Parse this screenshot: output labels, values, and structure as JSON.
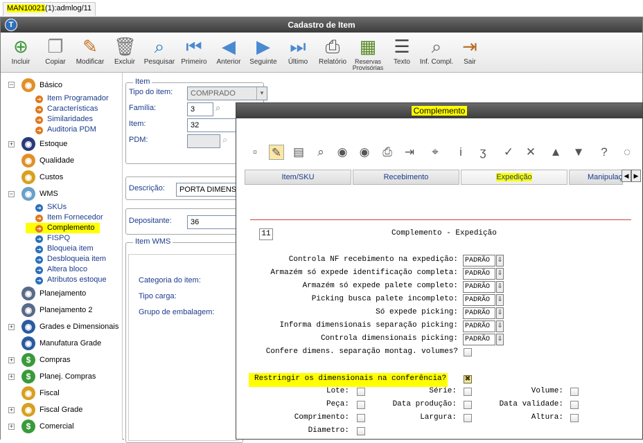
{
  "tab": {
    "highlighted": "MAN10021",
    "rest": "(1):admlog/11"
  },
  "window": {
    "title": "Cadastro de Item"
  },
  "toolbar": [
    {
      "label": "Incluir",
      "icon": "add-icon"
    },
    {
      "label": "Copiar",
      "icon": "copy-icon"
    },
    {
      "label": "Modificar",
      "icon": "edit-icon"
    },
    {
      "label": "Excluir",
      "icon": "trash-icon"
    },
    {
      "label": "Pesquisar",
      "icon": "search-icon"
    },
    {
      "label": "Primeiro",
      "icon": "first-icon"
    },
    {
      "label": "Anterior",
      "icon": "previous-icon"
    },
    {
      "label": "Seguinte",
      "icon": "next-icon"
    },
    {
      "label": "Último",
      "icon": "last-icon"
    },
    {
      "label": "Relatório",
      "icon": "printer-icon"
    },
    {
      "label": "Reservas Provisórias",
      "icon": "reserves-icon"
    },
    {
      "label": "Texto",
      "icon": "text-icon"
    },
    {
      "label": "Inf. Compl.",
      "icon": "info-icon"
    },
    {
      "label": "Sair",
      "icon": "exit-icon"
    }
  ],
  "tree": {
    "basico": "Básico",
    "basico_items": [
      "Item Programador",
      "Características",
      "Similaridades",
      "Auditoria PDM"
    ],
    "estoque": "Estoque",
    "qualidade": "Qualidade",
    "custos": "Custos",
    "wms": "WMS",
    "wms_items": [
      "SKUs",
      "Item Fornecedor",
      "Complemento",
      "FISPQ",
      "Bloqueia item",
      "Desbloqueia item",
      "Altera bloco",
      "Atributos estoque"
    ],
    "modules": [
      "Planejamento",
      "Planejamento 2",
      "Grades e Dimensionais",
      "Manufatura Grade",
      "Compras",
      "Planej. Compras",
      "Fiscal",
      "Fiscal Grade",
      "Comercial"
    ]
  },
  "form": {
    "item_legend": "Item",
    "tipo_label": "Tipo do item:",
    "tipo_value": "COMPRADO",
    "familia_label": "Família:",
    "familia_value": "3",
    "item_label": "Item:",
    "item_value": "32",
    "pdm_label": "PDM:",
    "descricao_label": "Descrição:",
    "descricao_value": "PORTA DIMENS N",
    "depositante_label": "Depositante:",
    "depositante_value": "36",
    "wms_legend": "Item WMS",
    "categoria_label": "Categoria do item:",
    "tipo_carga_label": "Tipo carga:",
    "grupo_label": "Grupo de embalagem:"
  },
  "dialog": {
    "title": "Complemento",
    "tabs": [
      "Item/SKU",
      "Recebimento",
      "Expedição",
      "Manipulação"
    ],
    "page": "11",
    "heading": "Complemento - Expedição",
    "combo_rows": [
      {
        "label": "Controla NF recebimento na expedição:",
        "value": "PADRÃO"
      },
      {
        "label": "Armazém só expede identificação completa:",
        "value": "PADRÃO"
      },
      {
        "label": "Armazém só expede palete completo:",
        "value": "PADRÃO"
      },
      {
        "label": "Picking busca palete incompleto:",
        "value": "PADRÃO"
      },
      {
        "label": "Só expede picking:",
        "value": "PADRÃO"
      },
      {
        "label": "Informa dimensionais separação picking:",
        "value": "PADRÃO"
      },
      {
        "label": "Controla dimensionais picking:",
        "value": "PADRÃO"
      }
    ],
    "confere_label": "Confere dimens. separação montag. volumes?",
    "restringir_label": "Restringir os dimensionais na conferência?",
    "checks": [
      "Lote:",
      "Série:",
      "Volume:",
      "Peça:",
      "Data produção:",
      "Data validade:",
      "Comprimento:",
      "Largura:",
      "Altura:",
      "Diametro:"
    ],
    "colors": {
      "highlight": "#ffff00",
      "title_bar": "#4a4a4a"
    }
  }
}
